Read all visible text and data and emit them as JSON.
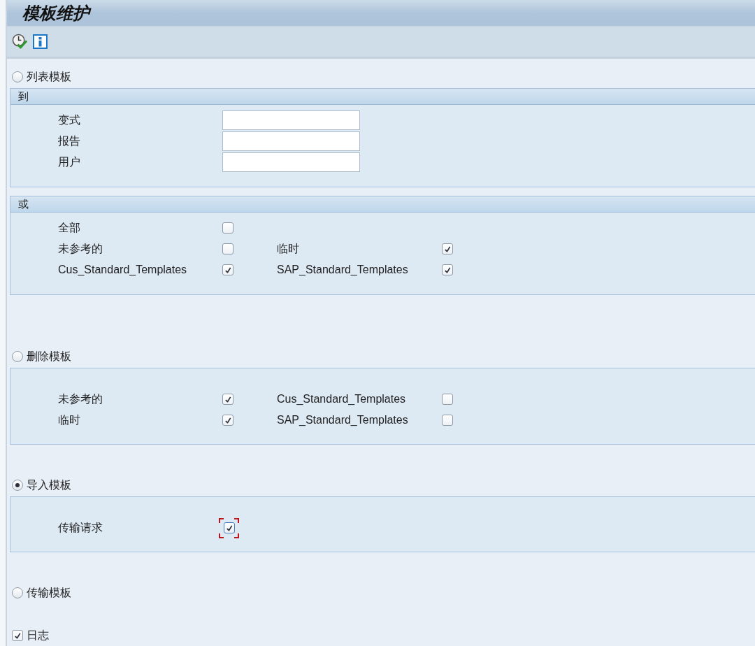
{
  "title": "模板维护",
  "sections": [
    {
      "label": "列表模板",
      "selected": false,
      "groups": [
        {
          "header": "到",
          "rows": [
            [
              {
                "kind": "field",
                "label": "变式"
              }
            ],
            [
              {
                "kind": "field",
                "label": "报告"
              }
            ],
            [
              {
                "kind": "field",
                "label": "用户"
              }
            ]
          ]
        },
        {
          "header": "或",
          "rows": [
            [
              {
                "kind": "check",
                "label": "全部",
                "checked": false,
                "focused": false
              }
            ],
            [
              {
                "kind": "check",
                "label": "未参考的",
                "checked": false,
                "focused": false
              },
              {
                "kind": "check",
                "label": "临时",
                "checked": true,
                "focused": false
              }
            ],
            [
              {
                "kind": "check",
                "label": "Cus_Standard_Templates",
                "checked": true,
                "focused": false
              },
              {
                "kind": "check",
                "label": "SAP_Standard_Templates",
                "checked": true,
                "focused": false
              }
            ]
          ]
        }
      ]
    },
    {
      "label": "删除模板",
      "selected": false,
      "groups": [
        {
          "rows": [
            [
              {
                "kind": "check",
                "label": "未参考的",
                "checked": true,
                "focused": false
              },
              {
                "kind": "check",
                "label": "Cus_Standard_Templates",
                "checked": false,
                "focused": false
              }
            ],
            [
              {
                "kind": "check",
                "label": "临时",
                "checked": true,
                "focused": false
              },
              {
                "kind": "check",
                "label": "SAP_Standard_Templates",
                "checked": false,
                "focused": false
              }
            ]
          ]
        }
      ]
    },
    {
      "label": "导入模板",
      "selected": true,
      "groups": [
        {
          "rows": [
            [
              {
                "kind": "check",
                "label": "传输请求",
                "checked": true,
                "focused": true
              }
            ]
          ]
        }
      ]
    },
    {
      "label": "传输模板",
      "selected": false
    }
  ],
  "log": {
    "label": "日志",
    "checked": true
  }
}
